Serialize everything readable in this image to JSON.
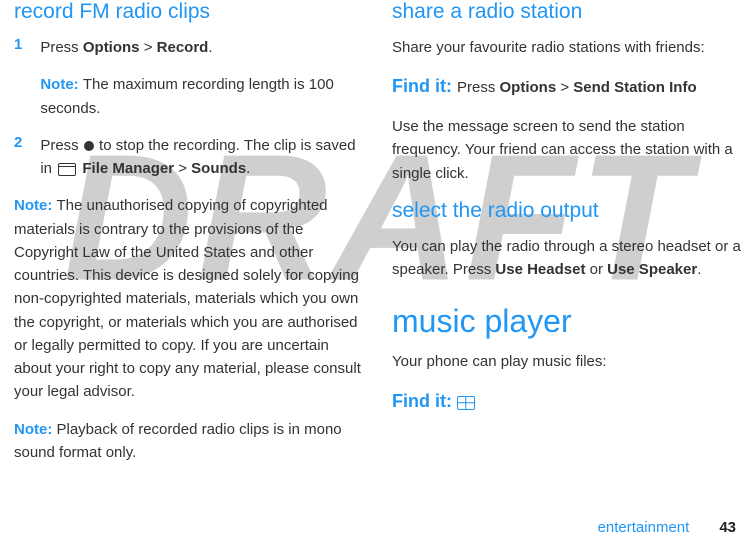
{
  "watermark": "DRAFT",
  "left": {
    "heading1": "record FM radio clips",
    "step1_num": "1",
    "step1_a": "Press ",
    "step1_b": "Options",
    "step1_c": " > ",
    "step1_d": "Record",
    "step1_e": ".",
    "note1_label": "Note: ",
    "note1_body": "The maximum recording length is 100 seconds.",
    "step2_num": "2",
    "step2_a": "Press ",
    "step2_b": " to stop the recording. The clip is saved in ",
    "step2_c": "File Manager",
    "step2_d": " > ",
    "step2_e": "Sounds",
    "step2_f": ".",
    "note2_label": "Note: ",
    "note2_body": "The unauthorised copying of copyrighted materials is contrary to the provisions of the Copyright Law of the United States and other countries. This device is designed solely for copying non-copyrighted materials, materials which you own the copyright, or materials which you are authorised or legally permitted to copy. If you are uncertain about your right to copy any material, please consult your legal advisor.",
    "note3_label": "Note: ",
    "note3_body": "Playback of recorded radio clips is in mono sound format only."
  },
  "right": {
    "heading1": "share a radio station",
    "p1": "Share your favourite radio stations with friends:",
    "findit1_label": "Find it: ",
    "findit1_a": "Press ",
    "findit1_b": "Options",
    "findit1_c": " > ",
    "findit1_d": "Send Station Info",
    "p2": "Use the message screen to send the station frequency. Your friend can access the station with a single click.",
    "heading2": "select the radio output",
    "p3_a": "You can play the radio through a stereo headset or a speaker. Press ",
    "p3_b": "Use Headset",
    "p3_c": " or ",
    "p3_d": "Use Speaker",
    "p3_e": ".",
    "main_heading": "music player",
    "p4": "Your phone can play music files:",
    "findit2_label": "Find it: "
  },
  "footer": {
    "section": "entertainment",
    "page": "43"
  }
}
